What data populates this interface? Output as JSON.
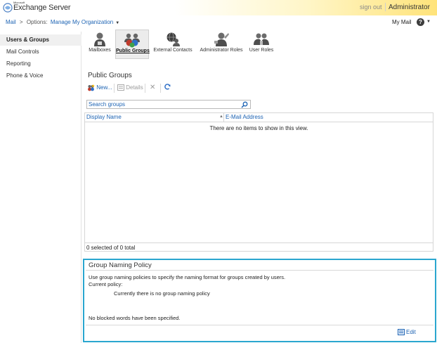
{
  "header": {
    "logo_brand": "Microsoft",
    "logo_product": "Exchange Server",
    "sign_out": "sign out",
    "user": "Administrator"
  },
  "breadcrumb": {
    "mail": "Mail",
    "separator": ">",
    "options_label": "Options:",
    "organization": "Manage My Organization",
    "my_mail": "My Mail",
    "help": "?"
  },
  "sidebar": {
    "items": [
      {
        "label": "Users & Groups",
        "active": true
      },
      {
        "label": "Mail Controls",
        "active": false
      },
      {
        "label": "Reporting",
        "active": false
      },
      {
        "label": "Phone & Voice",
        "active": false
      }
    ]
  },
  "tabs": [
    {
      "label": "Mailboxes",
      "icon": "mailbox-user-icon",
      "active": false
    },
    {
      "label": "Public Groups",
      "icon": "public-groups-icon",
      "active": true
    },
    {
      "label": "External Contacts",
      "icon": "external-contact-icon",
      "active": false
    },
    {
      "label": "Administrator Roles",
      "icon": "admin-roles-icon",
      "active": false
    },
    {
      "label": "User Roles",
      "icon": "user-roles-icon",
      "active": false
    }
  ],
  "main": {
    "title": "Public Groups",
    "toolbar": {
      "new_label": "New...",
      "details_label": "Details",
      "delete_icon": "delete-icon",
      "refresh_icon": "refresh-icon"
    },
    "search": {
      "placeholder": "Search groups"
    },
    "grid": {
      "columns": [
        "Display Name",
        "E-Mail Address"
      ],
      "empty_message": "There are no items to show in this view.",
      "footer": "0 selected of 0 total"
    }
  },
  "policy": {
    "title": "Group Naming Policy",
    "description": "Use group naming policies to specify the naming format for groups created by users.",
    "current_label": "Current policy:",
    "current_value": "Currently there is no group naming policy",
    "blocked_words": "No blocked words have been specified.",
    "edit_label": "Edit"
  },
  "colors": {
    "link": "#1e64b4",
    "panel_border": "#2aa6cf",
    "header_gradient_end": "#ffe37a"
  }
}
